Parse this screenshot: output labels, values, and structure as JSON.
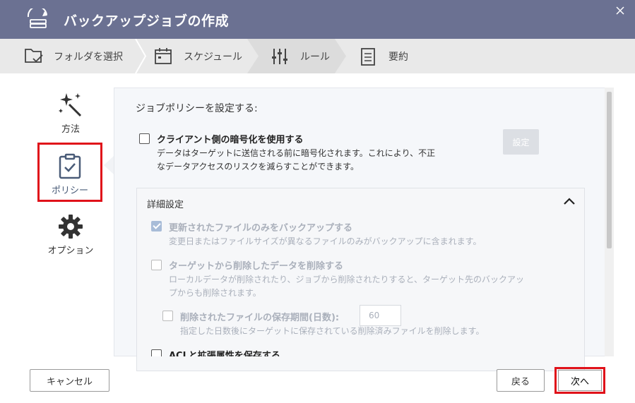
{
  "window": {
    "title": "バックアップジョブの作成"
  },
  "steps": [
    {
      "label": "フォルダを選択"
    },
    {
      "label": "スケジュール"
    },
    {
      "label": "ルール"
    },
    {
      "label": "要約"
    }
  ],
  "sidenav": {
    "method": "方法",
    "policy": "ポリシー",
    "options": "オプション"
  },
  "policy": {
    "heading": "ジョブポリシーを設定する:",
    "client_encryption": {
      "label": "クライアント側の暗号化を使用する",
      "desc_line1": "データはターゲットに送信される前に暗号化されます。これにより、不正",
      "desc_line2": "なデータアクセスのリスクを減らすことができます。",
      "setting_button": "設定"
    },
    "advanced": {
      "title": "詳細設定",
      "updated_only": {
        "label": "更新されたファイルのみをバックアップする",
        "desc": "変更日またはファイルサイズが異なるファイルのみがバックアップに含まれます。"
      },
      "delete_removed": {
        "label": "ターゲットから削除したデータを削除する",
        "desc_line1": "ローカルデータが削除されたり、ジョブから削除されたりすると、ターゲット先のバックアッ",
        "desc_line2": "プからも削除されます。"
      },
      "retention": {
        "label": "削除されたファイルの保存期間(日数):",
        "value": "60",
        "desc": "指定した日数後にターゲットに保存されている削除済みファイルを削除します。"
      },
      "acl": {
        "label": "ACLと拡張属性を保存する"
      }
    }
  },
  "footer": {
    "cancel": "キャンセル",
    "back": "戻る",
    "next": "次へ"
  },
  "colors": {
    "titlebar": "#6b7192",
    "highlight": "#e0121a"
  }
}
